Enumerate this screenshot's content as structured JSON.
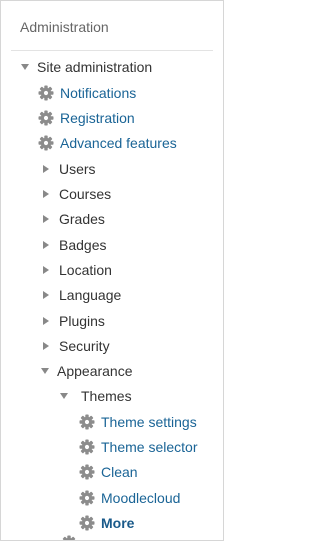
{
  "block": {
    "title": "Administration"
  },
  "tree": {
    "root_label": "Site administration",
    "links": {
      "notifications": "Notifications",
      "registration": "Registration",
      "advanced_features": "Advanced features"
    },
    "categories": {
      "users": "Users",
      "courses": "Courses",
      "grades": "Grades",
      "badges": "Badges",
      "location": "Location",
      "language": "Language",
      "plugins": "Plugins",
      "security": "Security",
      "appearance": "Appearance"
    },
    "appearance": {
      "themes_label": "Themes",
      "themes": {
        "theme_settings": "Theme settings",
        "theme_selector": "Theme selector",
        "clean": "Clean",
        "moodlecloud": "Moodlecloud",
        "more": "More"
      }
    }
  },
  "colors": {
    "link": "#1a6496",
    "text": "#333333",
    "caret": "#888888",
    "gear": "#8c8c8c"
  },
  "icons": {
    "expanded": "caret-down-icon",
    "collapsed": "caret-right-icon",
    "setting": "gear-icon"
  }
}
